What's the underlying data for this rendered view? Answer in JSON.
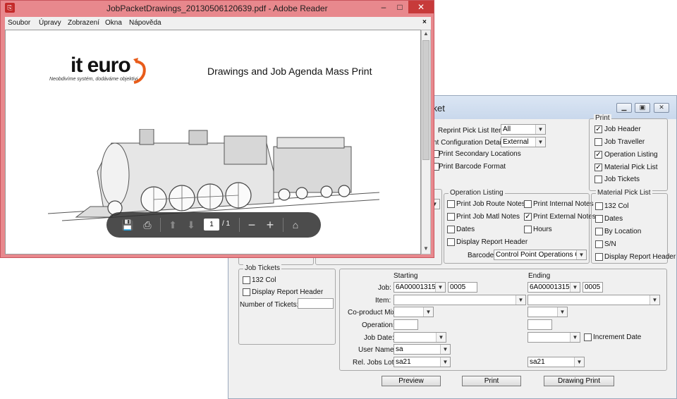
{
  "dialog": {
    "title": "cket",
    "print_group": {
      "title": "Print",
      "items": [
        {
          "label": "Job Header",
          "checked": true
        },
        {
          "label": "Job Traveller",
          "checked": false
        },
        {
          "label": "Operation Listing",
          "checked": true
        },
        {
          "label": "Material Pick List",
          "checked": true
        },
        {
          "label": "Job Tickets",
          "checked": false
        }
      ]
    },
    "top_options": {
      "reprint_label": "Reprint Pick List Items:",
      "reprint_value": "All",
      "config_label": "nt Configuration Details:",
      "config_value": "External",
      "secondary_label": "Print Secondary Locations",
      "barcode_format_label": "Print Barcode Format"
    },
    "operation_listing": {
      "title": "Operation Listing",
      "route_notes": "Print Job Route Notes",
      "internal_notes": "Print Internal Notes",
      "matl_notes": "Print Job Matl Notes",
      "external_notes": "Print External Notes",
      "dates": "Dates",
      "hours": "Hours",
      "display_header": "Display Report Header",
      "barcode_label": "Barcode:",
      "barcode_value": "Control Point Operations Only"
    },
    "material_pick_list": {
      "title": "Material Pick List",
      "items": [
        "132 Col",
        "Dates",
        "By Location",
        "S/N",
        "Display Report Header"
      ]
    },
    "job_tickets": {
      "title": "Job Tickets",
      "col132": "132 Col",
      "display_header": "Display Report Header",
      "num_label": "Number of Tickets:",
      "num_value": ""
    },
    "range": {
      "starting_label": "Starting",
      "ending_label": "Ending",
      "job_label": "Job:",
      "job_start": "6A00001315",
      "job_start_suffix": "0005",
      "job_end": "6A00001315",
      "job_end_suffix": "0005",
      "item_label": "Item:",
      "coproduct_label": "Co-product Mix:",
      "operation_label": "Operation:",
      "jobdate_label": "Job Date:",
      "increment_label": "Increment Date",
      "username_label": "User Name:",
      "username_value": "sa",
      "reljobs_label": "Rel. Jobs Lot:",
      "reljobs_start": "sa21",
      "reljobs_end": "sa21"
    },
    "buttons": {
      "preview": "Preview",
      "print": "Print",
      "drawing_print": "Drawing Print"
    }
  },
  "reader": {
    "title": "JobPacketDrawings_20130506120639.pdf - Adobe Reader",
    "menu": [
      "Soubor",
      "Úpravy",
      "Zobrazení",
      "Okna",
      "Nápověda"
    ],
    "logo_text": "it euro",
    "tagline": "Neobdivíme systém, dodáváme objektivi",
    "doc_title": "Drawings and Job Agenda Mass Print",
    "page_current": "1",
    "page_total": "/ 1"
  }
}
